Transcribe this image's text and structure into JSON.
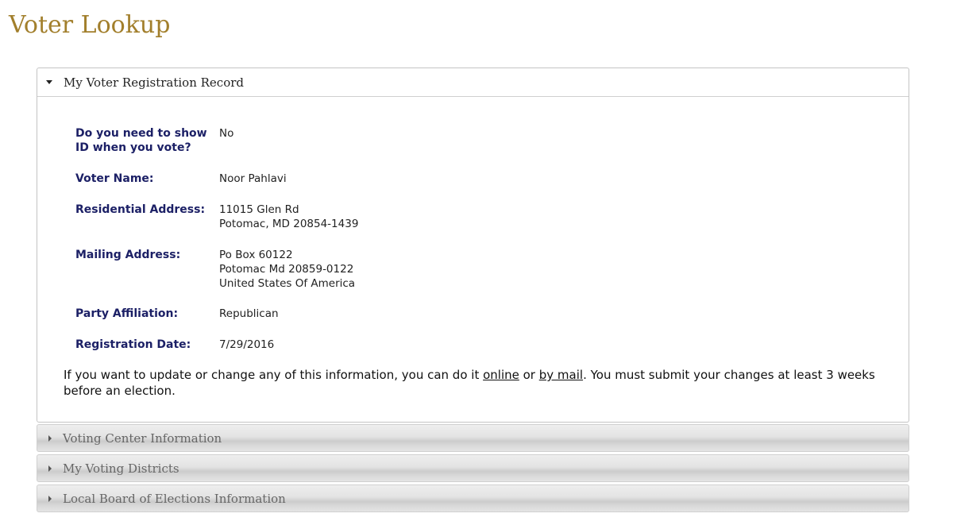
{
  "page": {
    "title": "Voter Lookup"
  },
  "registration_panel": {
    "title": "My Voter Registration Record",
    "expanded": true,
    "fields": [
      {
        "label": "Do you need to show ID when you vote?",
        "lines": [
          "No"
        ]
      },
      {
        "label": "Voter Name:",
        "lines": [
          "Noor Pahlavi"
        ]
      },
      {
        "label": "Residential Address:",
        "lines": [
          "11015 Glen Rd",
          "Potomac, MD 20854-1439"
        ]
      },
      {
        "label": "Mailing Address:",
        "lines": [
          "Po Box 60122",
          "Potomac Md 20859-0122",
          "United States Of America"
        ]
      },
      {
        "label": "Party Affiliation:",
        "lines": [
          "Republican"
        ]
      },
      {
        "label": "Registration Date:",
        "lines": [
          "7/29/2016"
        ]
      }
    ],
    "note": {
      "before": "If you want to update or change any of this information, you can do it ",
      "link_online": "online",
      "middle": " or ",
      "link_mail": "by mail",
      "after": ". You must submit your changes at least 3 weeks before an election."
    }
  },
  "collapsed_panels": [
    {
      "title": "Voting Center Information",
      "expanded": false
    },
    {
      "title": "My Voting Districts",
      "expanded": false
    },
    {
      "title": "Local Board of Elections Information",
      "expanded": false
    }
  ],
  "colors": {
    "title_gold": "#a27f2c",
    "label_navy": "#1c2066",
    "collapsed_title": "#666666"
  },
  "icons": {
    "expanded": "caret-down-icon",
    "collapsed": "caret-right-icon"
  }
}
